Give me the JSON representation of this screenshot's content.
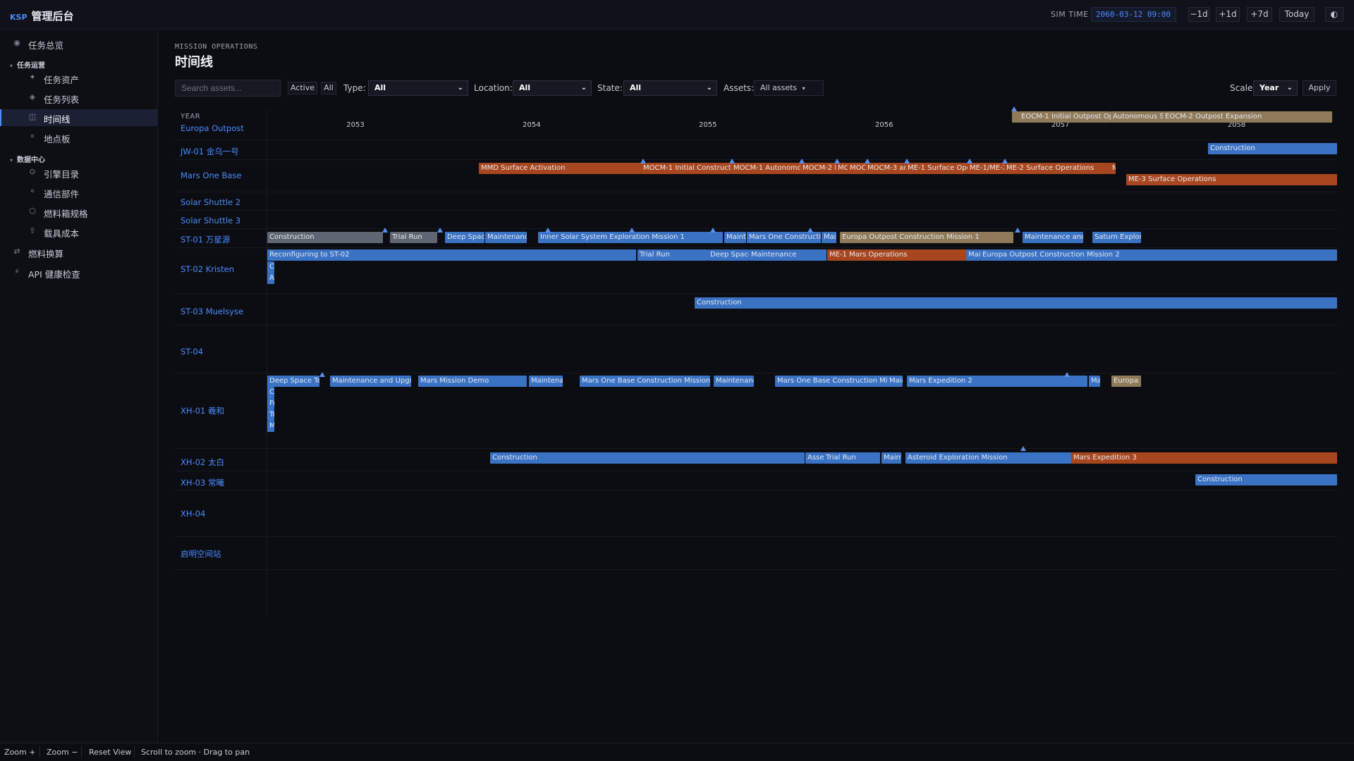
{
  "brand": {
    "ksp": "KSP",
    "title": "管理后台"
  },
  "topbar": {
    "sim_time_label": "SIM TIME",
    "sim_time_value": "2060-03-12 09:00",
    "buttons": [
      "−1d",
      "+1d",
      "+7d",
      "Today"
    ],
    "theme_icon": "◐"
  },
  "sidebar": {
    "overview": "任务总览",
    "group_ops": "任务运营",
    "assets": "任务资产",
    "missions": "任务列表",
    "timeline": "时间线",
    "locations": "地点板",
    "group_data": "数据中心",
    "engines": "引擎目录",
    "comms": "通信部件",
    "tanks": "燃料箱规格",
    "vehicle_cost": "载具成本",
    "fuel_calc": "燃料换算",
    "api_health": "API 健康检查"
  },
  "main": {
    "eyebrow": "MISSION OPERATIONS",
    "title": "时间线"
  },
  "filters": {
    "search_placeholder": "Search assets...",
    "chip_active": "Active",
    "chip_all": "All",
    "type_label": "Type:",
    "type_value": "All",
    "location_label": "Location:",
    "location_value": "All",
    "state_label": "State:",
    "state_value": "All",
    "assets_label": "Assets:",
    "assets_value": "All assets",
    "scale_label": "Scale:",
    "scale_value": "Year",
    "apply": "Apply"
  },
  "timeline": {
    "header": "YEAR",
    "years": [
      "2053",
      "2054",
      "2055",
      "2056",
      "2057",
      "2058"
    ],
    "year_range": [
      2052.5,
      2058.57
    ],
    "rows": [
      {
        "label": "Europa Outpost",
        "height": 44,
        "labelY": 20
      },
      {
        "label": "JW-01 金乌一号",
        "height": 28,
        "labelY": 8
      },
      {
        "label": "Mars One Base",
        "height": 46,
        "labelY": 15
      },
      {
        "label": "Solar Shuttle 2",
        "height": 26,
        "labelY": 7
      },
      {
        "label": "Solar Shuttle 3",
        "height": 26,
        "labelY": 7
      },
      {
        "label": "ST-01 万星源",
        "height": 27,
        "labelY": 7
      },
      {
        "label": "ST-02 Kristen",
        "height": 65,
        "labelY": 23
      },
      {
        "label": "ST-03 Muelsyse",
        "height": 45,
        "labelY": 18
      },
      {
        "label": "ST-04",
        "height": 68,
        "labelY": 30
      },
      {
        "label": "XH-01 羲和",
        "height": 107,
        "labelY": 45
      },
      {
        "label": "XH-02 太白",
        "height": 32,
        "labelY": 11
      },
      {
        "label": "XH-03 常曦",
        "height": 27,
        "labelY": 8
      },
      {
        "label": "XH-04",
        "height": 66,
        "labelY": 26
      },
      {
        "label": "启明空间站",
        "height": 47,
        "labelY": 16
      }
    ]
  },
  "footer": {
    "zoom_in": "Zoom +",
    "zoom_out": "Zoom −",
    "reset": "Reset View",
    "hint": "Scroll to zoom · Drag to pan"
  }
}
